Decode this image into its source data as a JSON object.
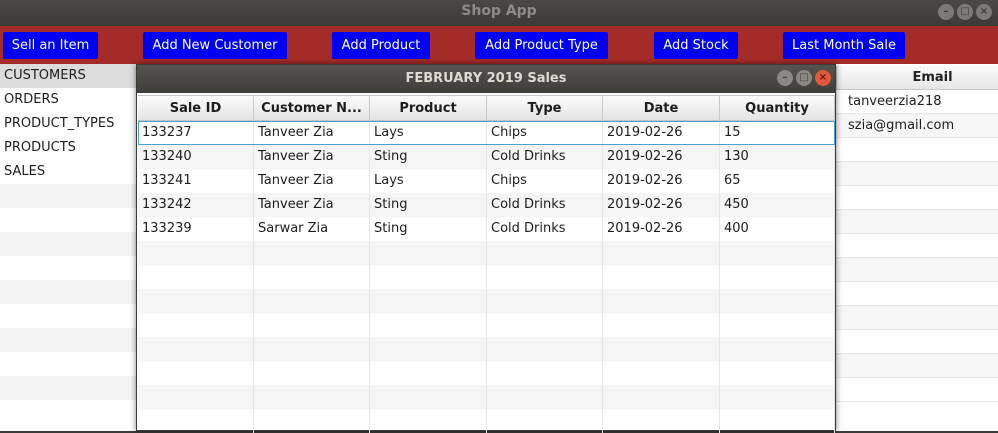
{
  "window": {
    "title": "Shop App"
  },
  "toolbar": {
    "buttons": [
      "Sell an Item",
      "Add New Customer",
      "Add Product",
      "Add Product Type",
      "Add Stock",
      "Last Month Sale"
    ]
  },
  "sidebar": {
    "items": [
      "CUSTOMERS",
      "ORDERS",
      "PRODUCT_TYPES",
      "PRODUCTS",
      "SALES"
    ],
    "selected": "CUSTOMERS"
  },
  "customers_table": {
    "header": "Email",
    "rows": [
      "tanveerzia218",
      "szia@gmail.com"
    ]
  },
  "dialog": {
    "title": "FEBRUARY 2019 Sales",
    "columns": [
      "Sale ID",
      "Customer N...",
      "Product",
      "Type",
      "Date",
      "Quantity"
    ],
    "rows": [
      [
        "133237",
        "Tanveer Zia",
        "Lays",
        "Chips",
        "2019-02-26",
        "15"
      ],
      [
        "133240",
        "Tanveer Zia",
        "Sting",
        "Cold Drinks",
        "2019-02-26",
        "130"
      ],
      [
        "133241",
        "Tanveer Zia",
        "Lays",
        "Chips",
        "2019-02-26",
        "65"
      ],
      [
        "133242",
        "Tanveer Zia",
        "Sting",
        "Cold Drinks",
        "2019-02-26",
        "450"
      ],
      [
        "133239",
        "Sarwar Zia",
        "Sting",
        "Cold Drinks",
        "2019-02-26",
        "400"
      ]
    ],
    "selected_row": 0
  },
  "colors": {
    "toolbar_bg": "#a52b28",
    "button_bg": "#0000f5",
    "button_text": "#ffffff",
    "selection_outline": "#4d9fd6"
  }
}
